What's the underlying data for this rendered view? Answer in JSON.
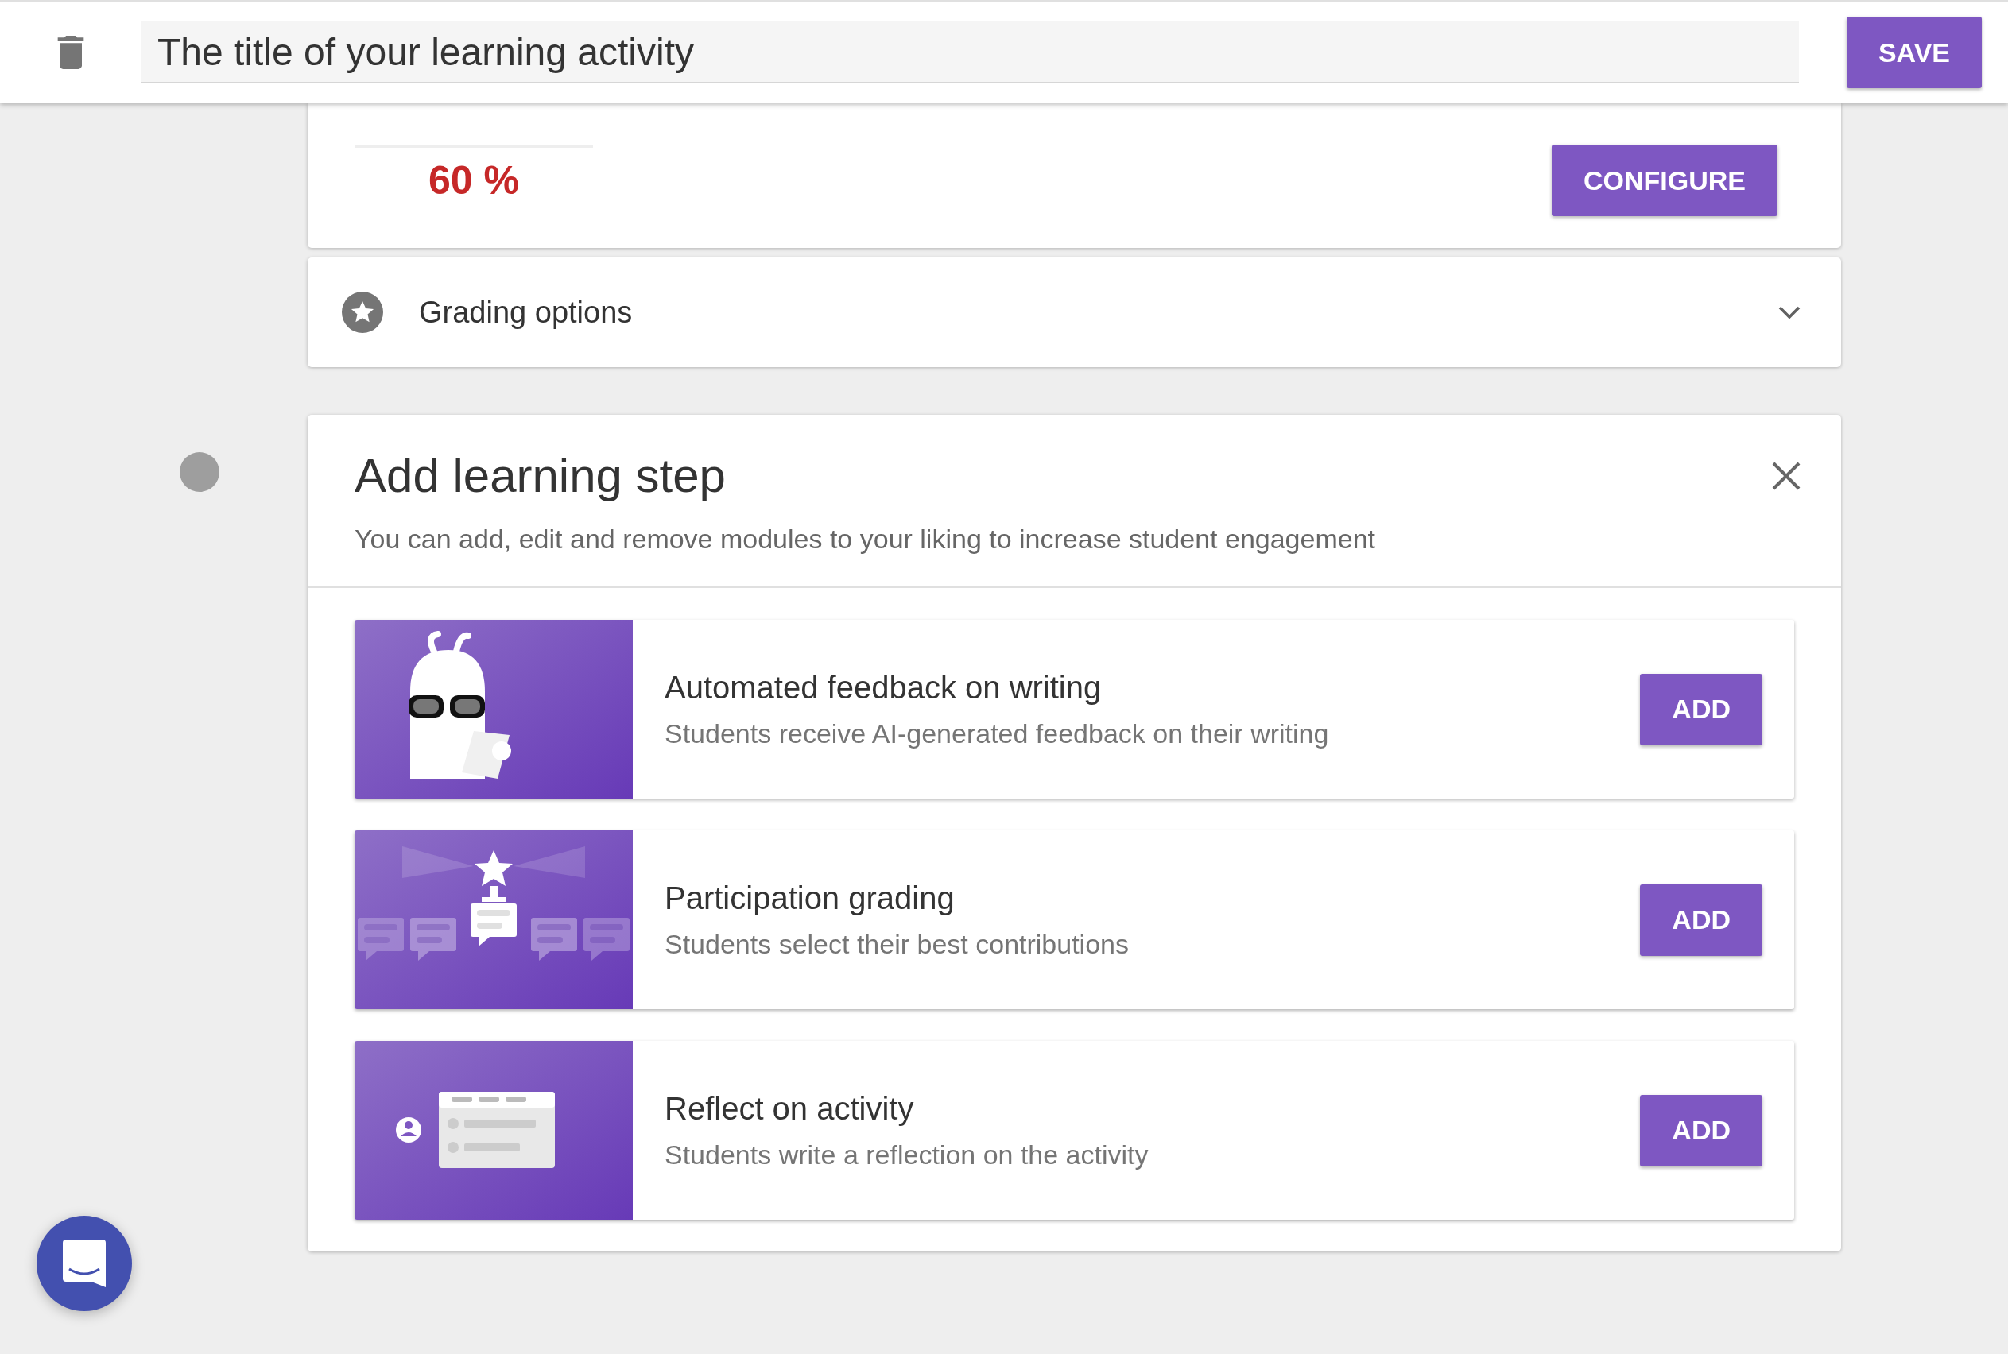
{
  "header": {
    "title_field": {
      "value": "The title of your learning activity"
    },
    "save_button": "SAVE"
  },
  "score_card": {
    "score": "60 %",
    "configure_button": "CONFIGURE"
  },
  "grading_options": {
    "label": "Grading options",
    "expanded": false
  },
  "add_step": {
    "title": "Add learning step",
    "description": "You can add, edit and remove modules to your liking to increase student engagement",
    "modules": [
      {
        "kind": "feedback",
        "title": "Automated feedback on writing",
        "description": "Students receive AI-generated feedback on their writing",
        "button": "ADD"
      },
      {
        "kind": "participation",
        "title": "Participation grading",
        "description": "Students select their best contributions",
        "button": "ADD"
      },
      {
        "kind": "reflection",
        "title": "Reflect on activity",
        "description": "Students write a reflection on the activity",
        "button": "ADD"
      }
    ]
  }
}
